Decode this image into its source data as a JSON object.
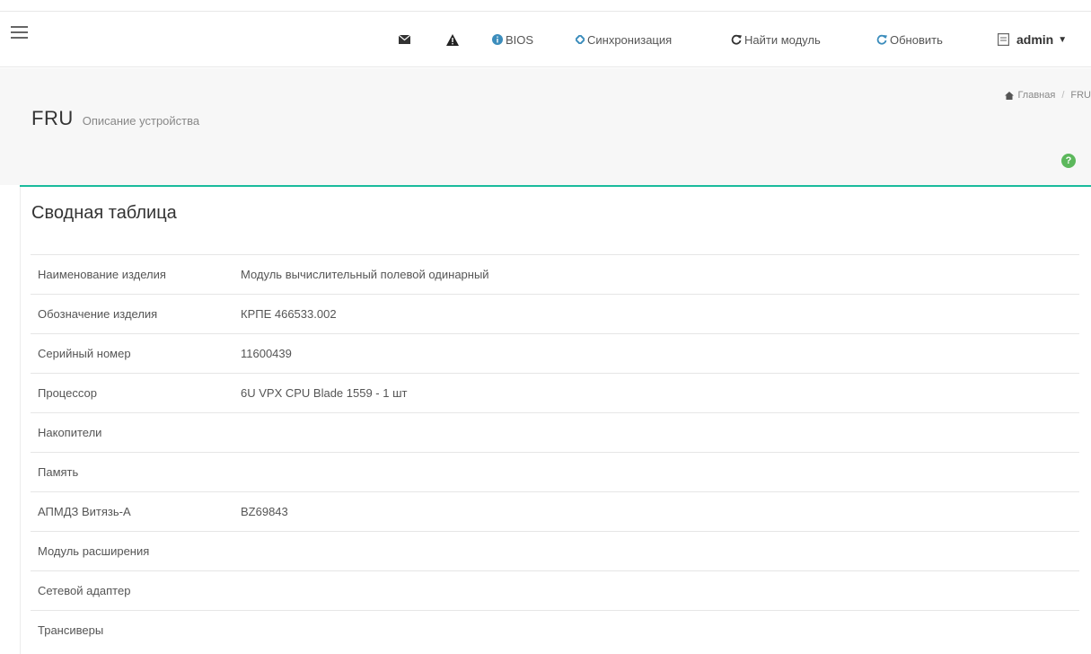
{
  "navbar": {
    "bios_label": "BIOS",
    "sync_label": "Синхронизация",
    "find_module_label": "Найти модуль",
    "refresh_label": "Обновить",
    "user_label": "admin"
  },
  "page": {
    "title": "FRU",
    "subtitle": "Описание устройства",
    "breadcrumb": {
      "home": "Главная",
      "current": "FRU"
    }
  },
  "panel": {
    "title": "Сводная таблица",
    "rows": [
      {
        "key": "Наименование изделия",
        "value": "Модуль вычислительный полевой одинарный"
      },
      {
        "key": "Обозначение изделия",
        "value": "КРПЕ 466533.002"
      },
      {
        "key": "Серийный номер",
        "value": "11600439"
      },
      {
        "key": "Процессор",
        "value": "6U VPX CPU Blade 1559 - 1 шт"
      },
      {
        "key": "Накопители",
        "value": ""
      },
      {
        "key": "Память",
        "value": ""
      },
      {
        "key": "АПМДЗ Витязь-А",
        "value": "BZ69843"
      },
      {
        "key": "Модуль расширения",
        "value": ""
      },
      {
        "key": "Сетевой адаптер",
        "value": ""
      },
      {
        "key": "Трансиверы",
        "value": ""
      }
    ]
  },
  "colors": {
    "accent": "#1ABB9C",
    "link_blue": "#3c8dbc",
    "help_green": "#5cb85c"
  }
}
